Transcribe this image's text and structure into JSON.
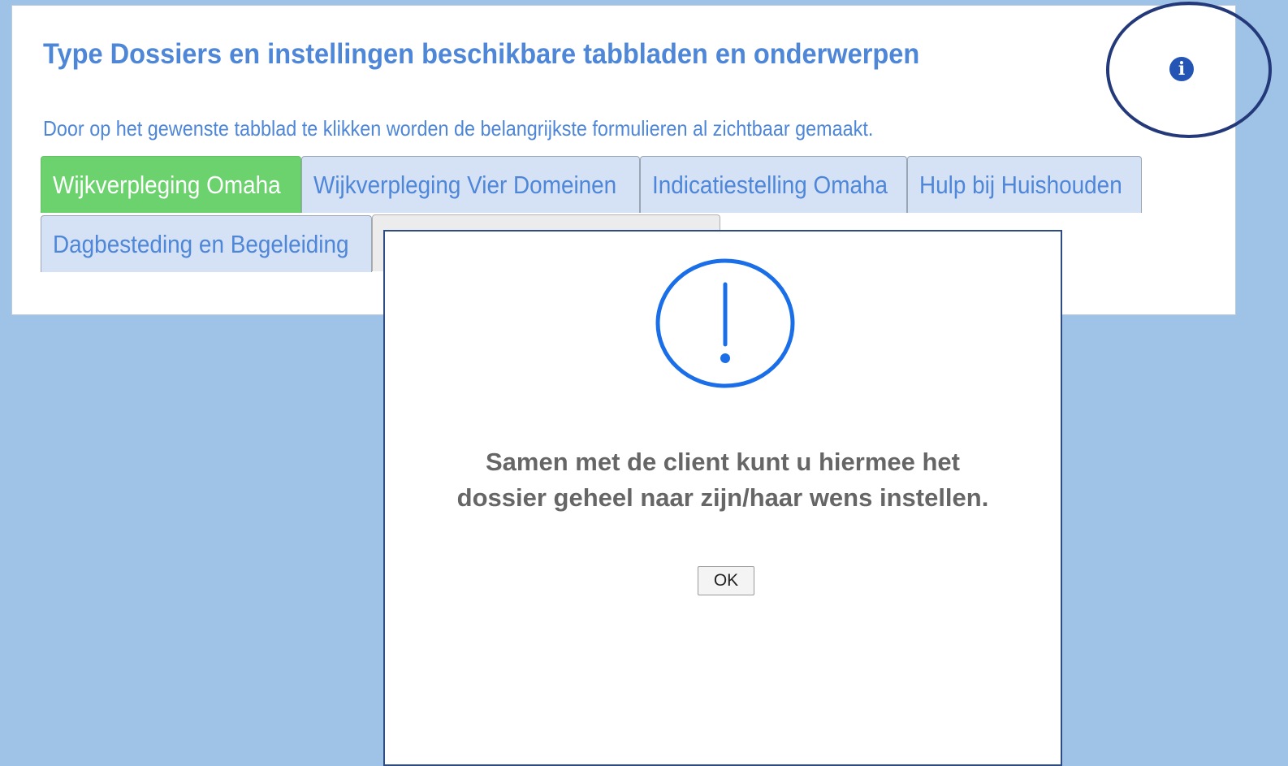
{
  "panel": {
    "title": "Type Dossiers en instellingen beschikbare tabbladen en onderwerpen",
    "intro": "Door op het gewenste tabblad te klikken worden de belangrijkste formulieren al zichtbaar gemaakt.",
    "tabs": [
      {
        "label": "Wijkverpleging Omaha",
        "active": true
      },
      {
        "label": "Wijkverpleging Vier Domeinen",
        "active": false
      },
      {
        "label": "Indicatiestelling Omaha",
        "active": false
      },
      {
        "label": "Hulp bij Huishouden",
        "active": false
      },
      {
        "label": "Dagbesteding en Begeleiding",
        "active": false
      },
      {
        "label": "",
        "active": false
      }
    ],
    "info_icon": "info-icon"
  },
  "modal": {
    "icon": "exclamation-circle-icon",
    "message_lines": [
      "Samen met de client kunt u hiermee het",
      "dossier geheel naar zijn/haar wens instellen."
    ],
    "ok_label": "OK"
  },
  "colors": {
    "background": "#9fc3e7",
    "accent_blue": "#4e86d8",
    "active_tab": "#6bd26d",
    "inactive_tab": "#d5e2f6",
    "highlight_ring": "#23397a",
    "alert_icon": "#1a6fe8"
  }
}
